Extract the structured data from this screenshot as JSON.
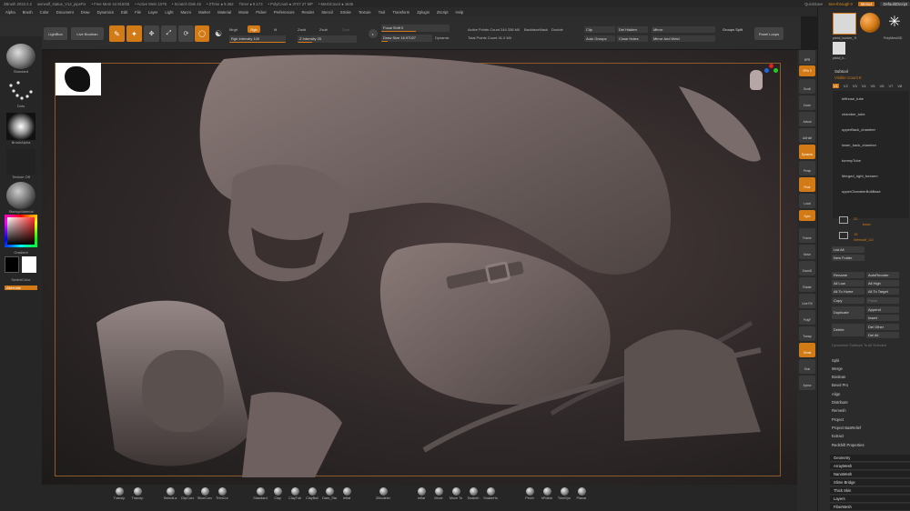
{
  "titlebar": {
    "app": "ZBrush 2023.2.2",
    "file": "werwolf_statue_V12_pipeFix",
    "stats": [
      "• Free Mem 44.915GB",
      "• Active Mem 1075",
      "• Scratch Disk 45",
      "• ZTime ● 9.362",
      "Timer ● 9.173",
      "• PolyCount ● 3747.27 MP",
      "• MeshCount ● 1645"
    ],
    "quicksave": "QuickSave",
    "see_through": "See-through 0",
    "menus_btn": "Menus",
    "default_script": "DefaultZScript"
  },
  "menubar": [
    "Alpha",
    "Brush",
    "Color",
    "Document",
    "Draw",
    "Dynamics",
    "Edit",
    "File",
    "Layer",
    "Light",
    "Macro",
    "Marker",
    "Material",
    "Movie",
    "Picker",
    "Preferences",
    "Render",
    "Stencil",
    "Stroke",
    "Texture",
    "Tool",
    "Transform",
    "Zplugin",
    "Zscript",
    "Help"
  ],
  "shelf": {
    "lightbox": "LightBox",
    "live_boolean": "Live Boolean",
    "edit": "Edit",
    "draw": "Draw",
    "move": "Move",
    "scale": "Scale",
    "rotate": "Rotate",
    "mrgb": "Mrgb",
    "rgb": "Rgb",
    "m": "M",
    "rgb_intensity": "Rgb Intensity 100",
    "zadd": "Zadd",
    "zsub": "Zsub",
    "zcut": "Zcut",
    "z_intensity": "Z Intensity 25",
    "focal_shift": "Focal Shift 0",
    "draw_size": "Draw Size 16.97027",
    "dynamic": "Dynamic",
    "active_points": "Active Points Count 244.338 Mil",
    "total_points": "Total Points Count 41.0 Mil",
    "active_points_sm": "ActivePoints: 244.338 Mil",
    "back_mask": "BackfaceMask",
    "double": "Double",
    "clip": "Clip",
    "del_hidden": "Del Hidden",
    "mirror": "Mirror",
    "groups_split": "Groups Split",
    "auto_groups": "Auto Groups",
    "close_holes": "Close Holes",
    "mirror_and_weld": "Mirror And Weld",
    "panel_loops": "Panel Loops"
  },
  "lefttray": {
    "brush": "Standard",
    "stroke": "Dots",
    "alpha": "BrushAlpha",
    "texture": "Texture Off",
    "material": "StartupMaterial",
    "gradient": "Gradient",
    "switch_color": "SwitchColor",
    "alternate": "Alternate"
  },
  "bottomshelf": [
    "TransIp",
    "TransIp",
    "SelectLa",
    "ClipCurv",
    "SliceCurv",
    "TrimCur",
    "Standard",
    "Clay",
    "ClayTub",
    "ClayBuil",
    "Dam_Sta",
    "Inflat",
    "ZModeler",
    "Inflat",
    "Move",
    "Move To",
    "Snakeh",
    "SnakeHo",
    "Pinch",
    "hPolish",
    "TrimDyn",
    "Planar"
  ],
  "righttray": [
    "BPR",
    "SPix 3",
    "Scroll",
    "Zoom",
    "Actual",
    "AAHalf",
    "Dynamic",
    "Persp",
    "Floor",
    "Local",
    "Gyro",
    "Frame",
    "Move",
    "ZoomD",
    "Rotate",
    "Line Fill",
    "PolyF",
    "Transp",
    "Ghost",
    "Solo",
    "Xpose"
  ],
  "rpanel": {
    "tool_name": "pistol_bunker_Tr",
    "tools": [
      "pistol_bunker_Tr",
      "ZSphere",
      "SimpleBrush",
      "PolyMesh3D",
      "pistol_b..."
    ],
    "subtool_title": "Subtool",
    "visible_count": "Visible Count 8",
    "visible_sets": [
      "V1",
      "V2",
      "V3",
      "V4",
      "V5",
      "V6",
      "V7",
      "V8"
    ],
    "subtools": [
      "lefthose_tube",
      "chamber_tube",
      "upperBack_chamber",
      "lower_back_chamber",
      "tummyTube",
      "Merged_right_forearm",
      "upperChamberBoltBase"
    ],
    "folders": [
      {
        "count": "22",
        "name": "base"
      },
      {
        "count": "15",
        "name": "Werwolf_U2"
      }
    ],
    "list_all": "List All",
    "new_folder": "New Folder",
    "buttons": [
      [
        "Rename",
        "AutoReorder"
      ],
      [
        "All Low",
        "All High"
      ],
      [
        "All To Home",
        "All To Target"
      ],
      [
        "Copy",
        "Paste"
      ],
      [
        "Duplicate",
        "Append"
      ],
      [
        "",
        "Insert"
      ],
      [
        "Delete",
        "Del Other"
      ],
      [
        "",
        "Del All"
      ]
    ],
    "split_label": "Dynamesh Subtools To All Selected",
    "menu": [
      "Split",
      "Merge",
      "Boolean",
      "Bevel Pro",
      "Align",
      "Distribute",
      "Remesh",
      "Project",
      "Project BasRelief",
      "Extract",
      "Redshift Properties"
    ],
    "sections": [
      "Geometry",
      "ArrayMesh",
      "NanoMesh",
      "Slime Bridge",
      "Thick Skin",
      "Layers",
      "FiberMesh"
    ]
  },
  "colors": {
    "accent": "#d27a16",
    "panel": "#2b2b2b",
    "viewport": "#3a3030"
  }
}
